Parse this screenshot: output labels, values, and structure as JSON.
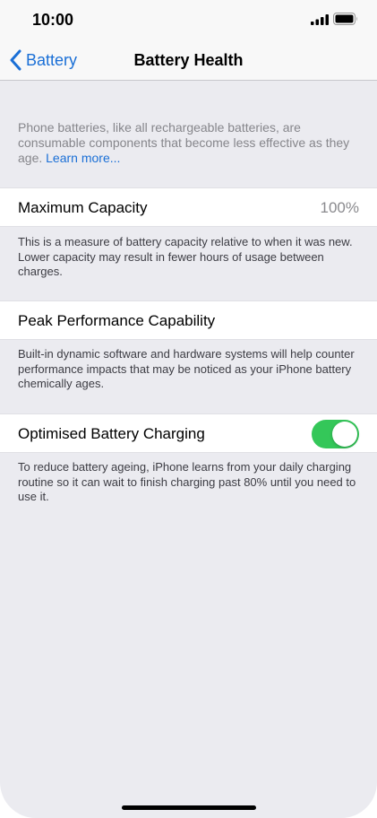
{
  "status_bar": {
    "time": "10:00"
  },
  "nav": {
    "back_label": "Battery",
    "title": "Battery Health"
  },
  "intro": {
    "text": "Phone batteries, like all rechargeable batteries, are consumable components that become less effective as they age. ",
    "link": "Learn more..."
  },
  "maximum_capacity": {
    "label": "Maximum Capacity",
    "value": "100%",
    "footnote": "This is a measure of battery capacity relative to when it was new. Lower capacity may result in fewer hours of usage between charges."
  },
  "peak_performance": {
    "label": "Peak Performance Capability",
    "footnote": "Built-in dynamic software and hardware systems will help counter performance impacts that may be noticed as your iPhone battery chemically ages."
  },
  "optimised_charging": {
    "label": "Optimised Battery Charging",
    "enabled": true,
    "footnote": "To reduce battery ageing, iPhone learns from your daily charging routine so it can wait to finish charging past 80% until you need to use it."
  },
  "colors": {
    "accent": "#1a6fd6",
    "toggle_on": "#34c759",
    "background": "#ebebf0"
  }
}
